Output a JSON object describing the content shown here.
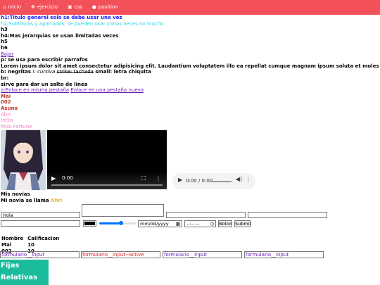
{
  "nav": {
    "items": [
      {
        "icon": "home-icon",
        "glyph": "⌂",
        "label": "Inicio"
      },
      {
        "icon": "gamepad-icon",
        "glyph": "✥",
        "label": "ejercicio"
      },
      {
        "icon": "css3-icon",
        "glyph": "▣",
        "label": "css"
      },
      {
        "icon": "location-icon",
        "glyph": "●",
        "label": "position"
      }
    ]
  },
  "lines": {
    "h1": "h1:Titulo general solo se debe usar una vez",
    "h2": "h2:Subtitulos y apartados, se pueden usar varias veces no mucho",
    "h3": "h3",
    "h4": "h4:Mas jerarquias se usan limitadas veces",
    "h5": "h5",
    "h6": "h6",
    "link_bajar": "Bajar",
    "p": "p: se usa para escribir parrafos",
    "lorem": "Lorem ipsum dolor sit amet consectetur adipisicing elit. Laudantium voluptatem illo ea repellat cumque magnam ipsum soluta et molestias assumenda?",
    "b_prefix": "b: negritas",
    "i_text": "i: cursiva",
    "strike_text": "strike: tachada",
    "small_text": "small: letra chiquita",
    "br": "br:",
    "br_desc": "sirve para dar un salto de linea",
    "link_same": "a:Enlace en misma pestaña",
    "link_new": "Enlace en una pestaña nueva",
    "mai": "Mai",
    "n002": "002",
    "asuna": "Asuna",
    "ahri": "Ahri",
    "irelia": "Irelia",
    "fortune": "Miss Fortune"
  },
  "video": {
    "time": "0:00"
  },
  "audio": {
    "time": "0:00 / 0:00"
  },
  "novias": {
    "title": "Mis novias",
    "sentence": "Mi novia se llama",
    "name": "Ahri"
  },
  "form": {
    "hola_value": "Hola",
    "color_value": "#000000",
    "range_value": 0.6,
    "date_placeholder": "mm/dd/yyyy",
    "time_placeholder": "--:-- --",
    "boton_label": "Boton",
    "submit_label": "Submit"
  },
  "table": {
    "headers": [
      "Nombre",
      "Calificacion"
    ],
    "rows": [
      [
        "Mai",
        "10"
      ],
      [
        "002",
        "10"
      ]
    ]
  },
  "formulario": [
    {
      "text": "formulario__input",
      "color": "#6a1bb5"
    },
    {
      "text": "formulario__input--active",
      "color": "#d61f1f"
    },
    {
      "text": "formulario__input",
      "color": "#6a1bb5"
    },
    {
      "text": "formulario__input",
      "color": "#6a1bb5"
    }
  ],
  "position": {
    "fijas": "Fijas",
    "relativas": "Relativas"
  },
  "colors": {
    "nav": "#f3515a",
    "teal": "#1abc9c",
    "link": "#6a1bb5"
  }
}
